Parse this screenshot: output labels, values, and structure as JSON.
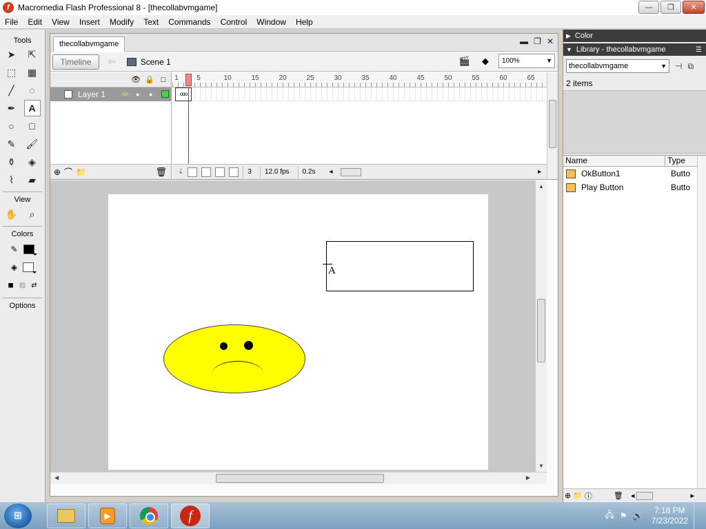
{
  "window": {
    "title": "Macromedia Flash Professional 8 - [thecollabvmgame]",
    "minimize": "—",
    "restore": "❐",
    "close": "✕"
  },
  "menu": [
    "File",
    "Edit",
    "View",
    "Insert",
    "Modify",
    "Text",
    "Commands",
    "Control",
    "Window",
    "Help"
  ],
  "tools": {
    "header": "Tools",
    "view_label": "View",
    "colors_label": "Colors",
    "options_label": "Options"
  },
  "document": {
    "tab": "thecollabvmgame",
    "timeline_button": "Timeline",
    "scene": "Scene 1",
    "zoom": "100%"
  },
  "timeline": {
    "layer_name": "Layer 1",
    "keyframe_marks": "ooo",
    "ruler": [
      "1",
      "5",
      "10",
      "15",
      "20",
      "25",
      "30",
      "35",
      "40",
      "45",
      "50",
      "55",
      "60",
      "65"
    ],
    "current_frame": "3",
    "fps": "12.0 fps",
    "elapsed": "0.2s"
  },
  "stage": {
    "text_tool_cursor": "A"
  },
  "panels": {
    "color_title": "Color",
    "library_title": "Library - thecollabvmgame",
    "library_select": "thecollabvmgame",
    "items_count": "2 items",
    "col_name": "Name",
    "col_type": "Type",
    "items": [
      {
        "name": "OkButton1",
        "type": "Butto"
      },
      {
        "name": "Play Button",
        "type": "Butto"
      }
    ]
  },
  "taskbar": {
    "time": "7:18 PM",
    "date": "7/23/2022"
  },
  "colors": {
    "smiley_fill": "#ffff00",
    "flash_red": "#c9250f",
    "layer_highlight": "#9a9a9a",
    "stage_bg": "#c8c8c8"
  }
}
